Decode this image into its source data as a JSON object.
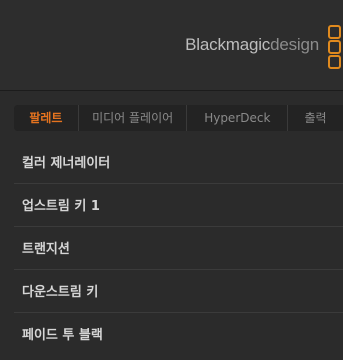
{
  "header": {
    "brand_bold": "Blackmagic",
    "brand_light": "design",
    "logo_icon": "blackmagic-logo-icon",
    "accent_color": "#e08a1e"
  },
  "tabs": [
    {
      "label": "팔레트",
      "active": true
    },
    {
      "label": "미디어 플레이어",
      "active": false
    },
    {
      "label": "HyperDeck",
      "active": false
    },
    {
      "label": "출력",
      "active": false
    }
  ],
  "palettes": [
    {
      "label": "컬러 제너레이터"
    },
    {
      "label": "업스트림 키 1"
    },
    {
      "label": "트랜지션"
    },
    {
      "label": "다운스트림 키"
    },
    {
      "label": "페이드 투 블랙"
    }
  ]
}
